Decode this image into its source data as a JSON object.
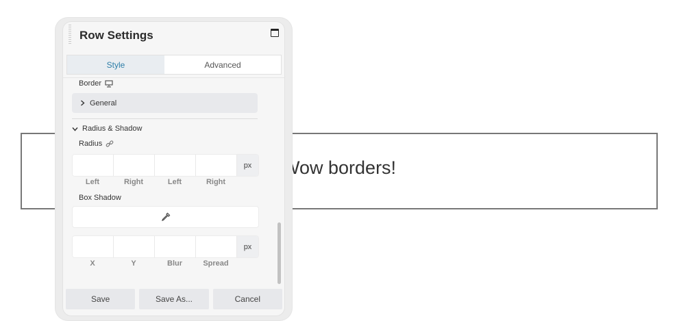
{
  "content": {
    "text": "Wow borders!"
  },
  "panel": {
    "title": "Row Settings",
    "tabs": [
      {
        "label": "Style",
        "active": true
      },
      {
        "label": "Advanced",
        "active": false
      }
    ],
    "border_label": "Border",
    "general_label": "General",
    "radius_shadow_label": "Radius & Shadow",
    "radius_label": "Radius",
    "radius_inputs": {
      "values": [
        "",
        "",
        "",
        ""
      ],
      "unit": "px"
    },
    "radius_sublabels": [
      "Left",
      "Right",
      "Left",
      "Right"
    ],
    "box_shadow_label": "Box Shadow",
    "shadow_inputs": {
      "values": [
        "",
        "",
        "",
        ""
      ],
      "unit": "px"
    },
    "shadow_sublabels": [
      "X",
      "Y",
      "Blur",
      "Spread"
    ],
    "footer": {
      "save": "Save",
      "save_as": "Save As...",
      "cancel": "Cancel"
    }
  },
  "colors": {
    "accent": "#2d7ea8",
    "row_border": "#777777"
  }
}
